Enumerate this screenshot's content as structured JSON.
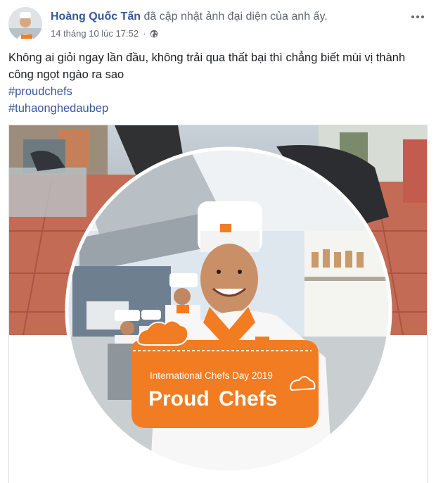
{
  "post": {
    "author": "Hoàng Quốc Tấn",
    "action": "đã cập nhật ảnh đại diện của anh ấy.",
    "timestamp": "14 tháng 10 lúc 17:52",
    "audience_icon": "globe-icon",
    "more_icon": "more-options-icon",
    "text_line": "Không ai giỏi ngay lần đầu, không trải qua thất bại thì chẳng biết mùi vị thành công ngọt ngào ra sao",
    "hashtags": [
      "#proudchefs",
      "#tuhaonghedaubep"
    ]
  },
  "photo": {
    "badge_title": "International Chefs Day 2019",
    "badge_word1": "Proud",
    "badge_word2": "Chefs"
  },
  "colors": {
    "link": "#385898",
    "meta": "#616770",
    "text": "#1c1e21",
    "orange": "#f27c22"
  }
}
